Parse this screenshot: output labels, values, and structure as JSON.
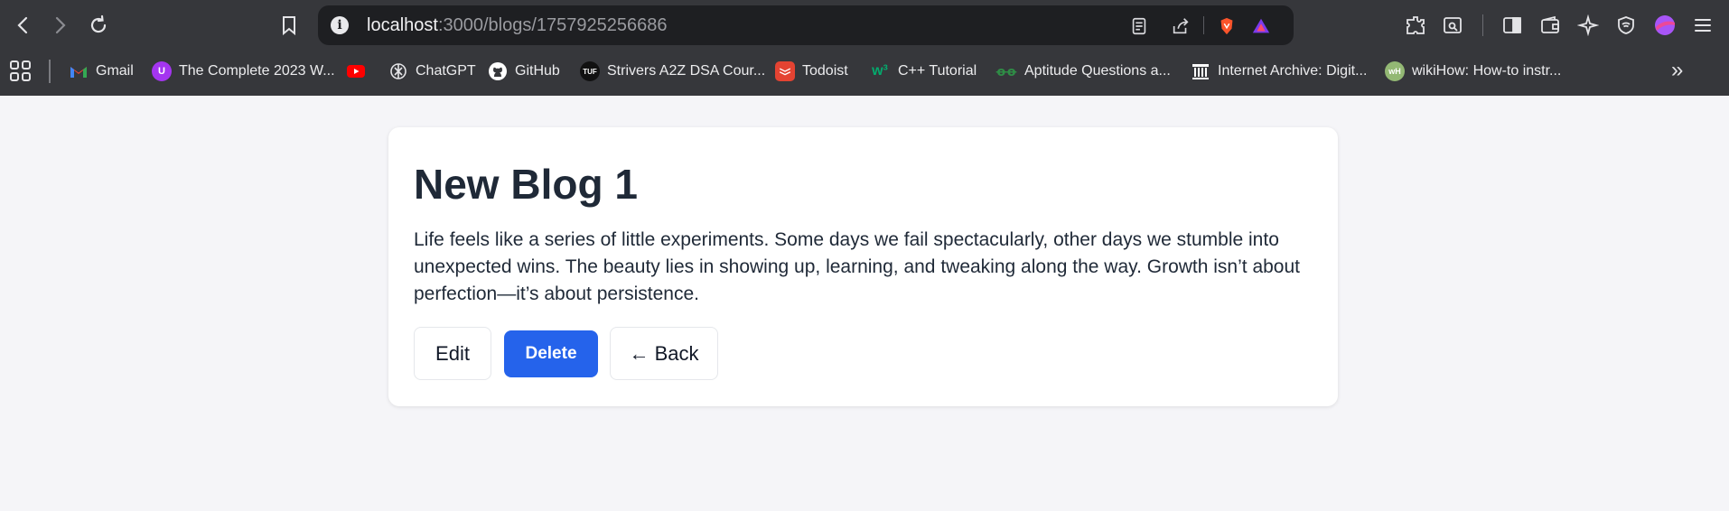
{
  "browser": {
    "url_host": "localhost",
    "url_path": ":3000/blogs/1757925256686",
    "accent_color": "#2563eb",
    "bookmarks": [
      {
        "label": "Gmail",
        "icon": "gmail-icon",
        "color": "#ea4335"
      },
      {
        "label": "The Complete 2023 W...",
        "icon": "udemy-icon",
        "color": "#a435f0"
      },
      {
        "label": "",
        "icon": "youtube-icon",
        "color": "#ff0000"
      },
      {
        "label": "ChatGPT",
        "icon": "chatgpt-icon",
        "color": "#e4e4e7"
      },
      {
        "label": "GitHub",
        "icon": "github-icon",
        "color": "#ffffff"
      },
      {
        "label": "Strivers A2Z DSA Cour...",
        "icon": "tuf-icon",
        "color": "#111111"
      },
      {
        "label": "Todoist",
        "icon": "todoist-icon",
        "color": "#e44332"
      },
      {
        "label": "C++ Tutorial",
        "icon": "w3schools-icon",
        "color": "#04aa6d"
      },
      {
        "label": "Aptitude Questions a...",
        "icon": "geeksforgeeks-icon",
        "color": "#2f8d46"
      },
      {
        "label": "Internet Archive: Digit...",
        "icon": "archive-icon",
        "color": "#ffffff"
      },
      {
        "label": "wikiHow: How-to instr...",
        "icon": "wikihow-icon",
        "color": "#93b874"
      }
    ]
  },
  "blog": {
    "title": "New Blog 1",
    "content": "Life feels like a series of little experiments. Some days we fail spectacularly, other days we stumble into unexpected wins. The beauty lies in showing up, learning, and tweaking along the way. Growth isn’t about perfection—it’s about persistence.",
    "edit_label": "Edit",
    "delete_label": "Delete",
    "back_label": "← Back"
  }
}
